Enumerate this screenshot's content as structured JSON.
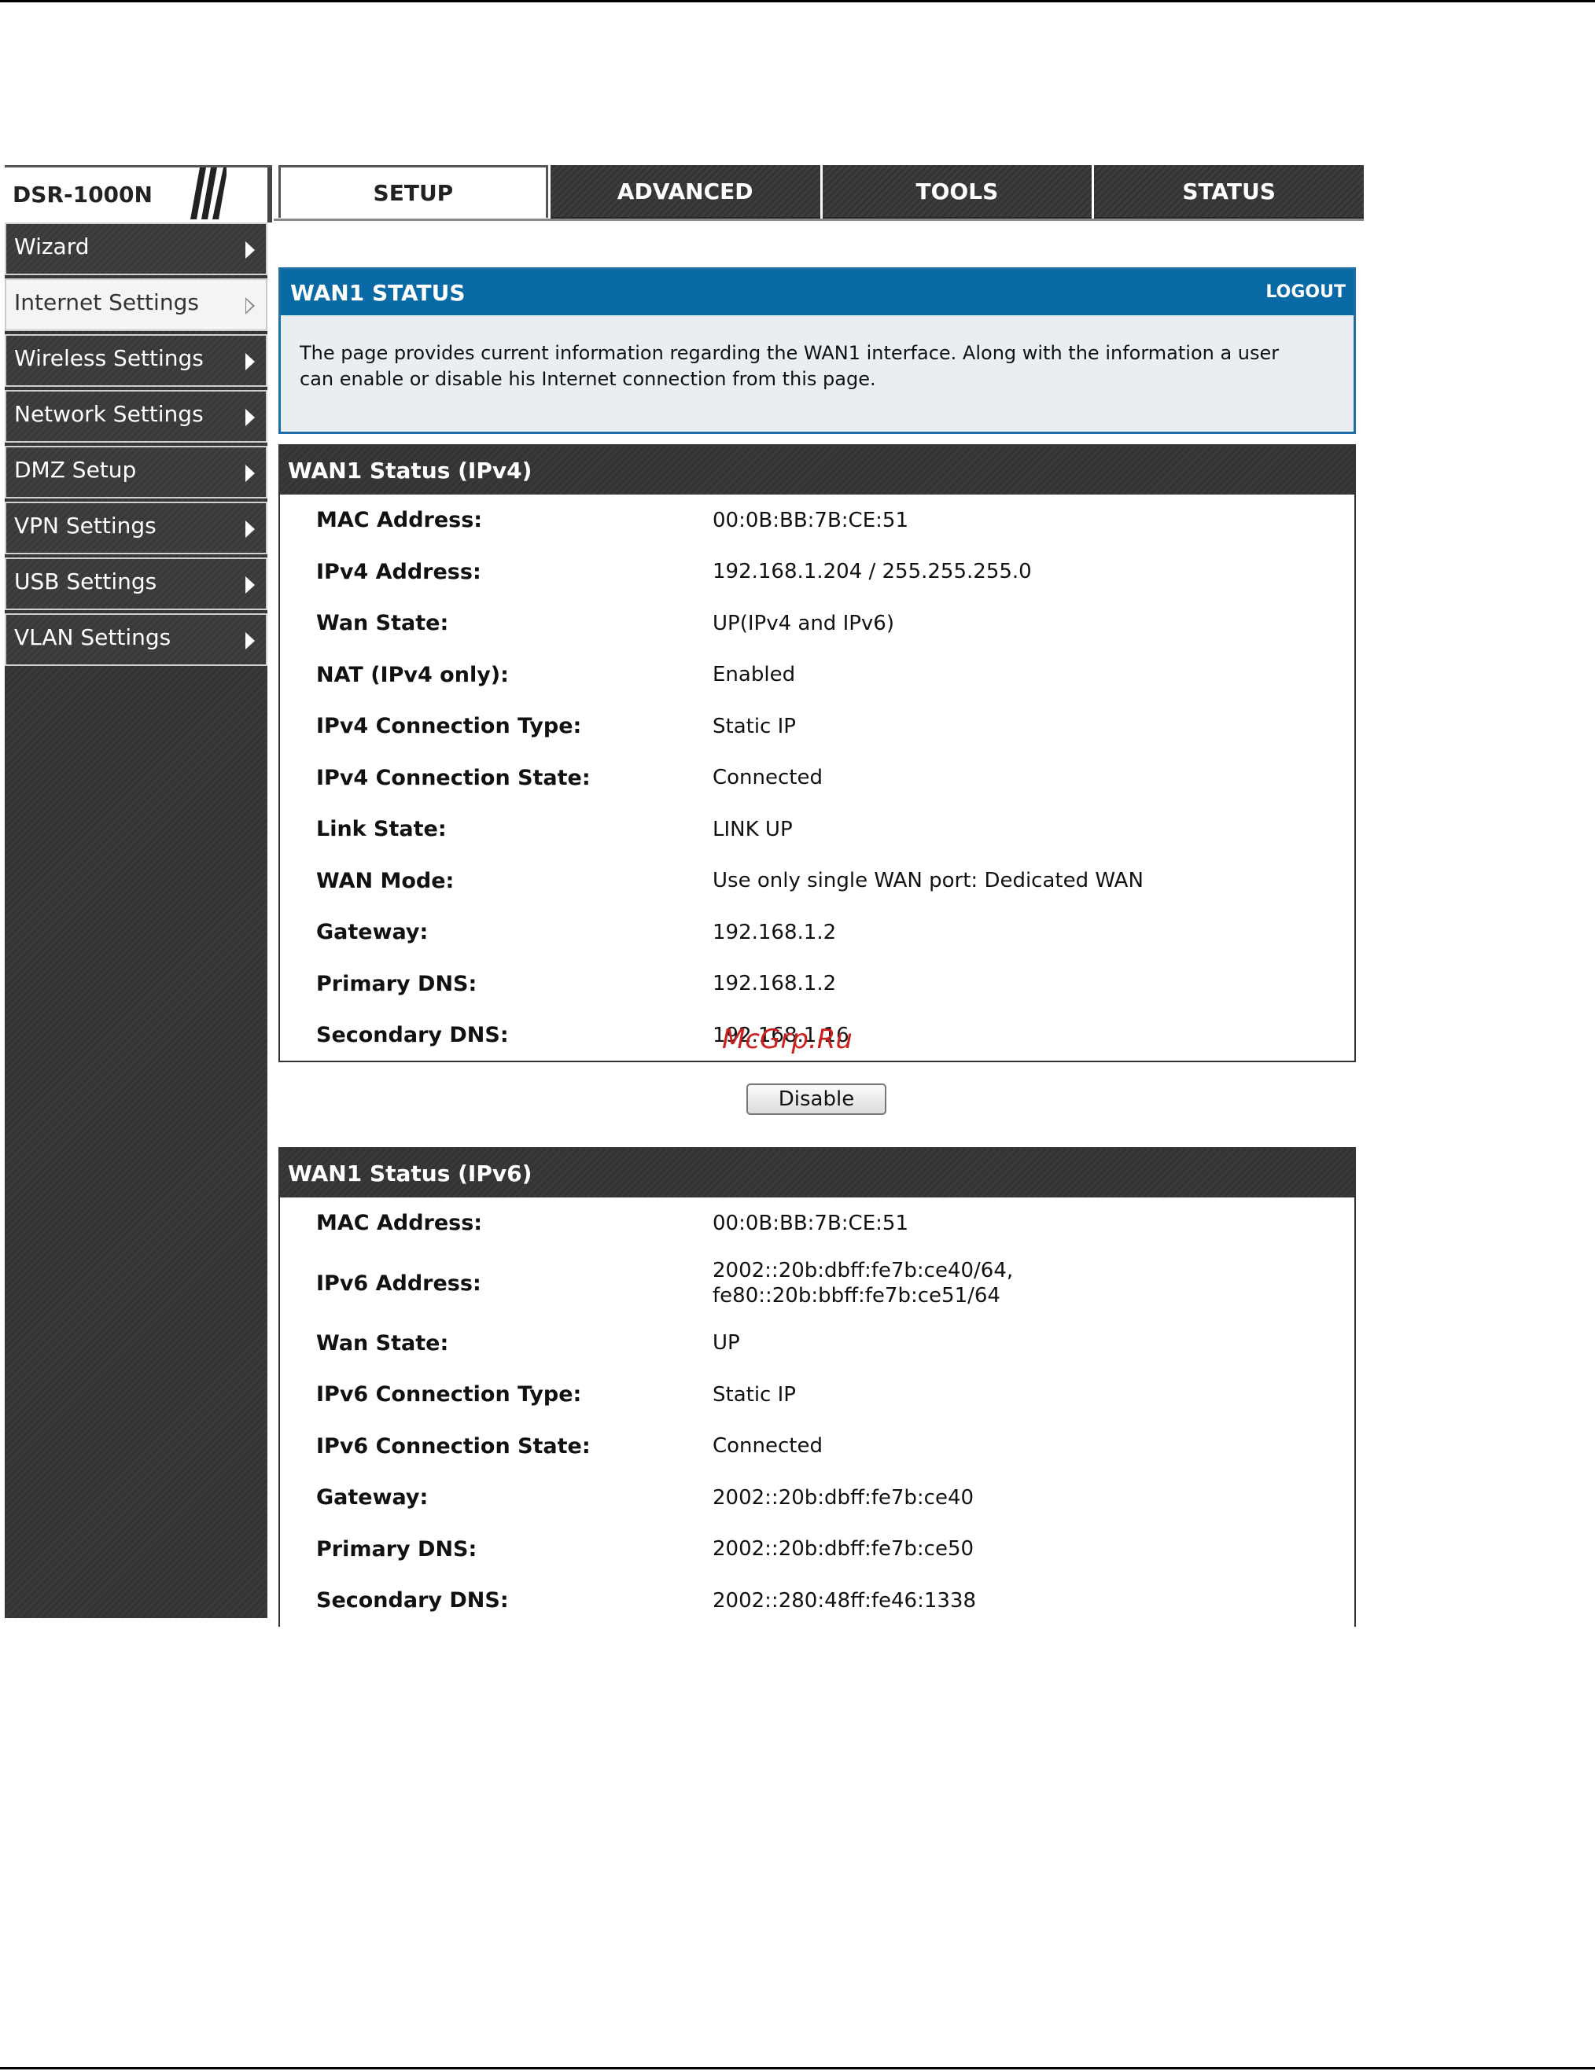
{
  "header": {
    "brand": "DSR-1000N",
    "tabs": [
      {
        "label": "SETUP",
        "active": true
      },
      {
        "label": "ADVANCED",
        "active": false
      },
      {
        "label": "TOOLS",
        "active": false
      },
      {
        "label": "STATUS",
        "active": false
      }
    ]
  },
  "sidebar": {
    "items": [
      {
        "label": "Wizard",
        "active": false
      },
      {
        "label": "Internet Settings",
        "active": true
      },
      {
        "label": "Wireless Settings",
        "active": false
      },
      {
        "label": "Network Settings",
        "active": false
      },
      {
        "label": "DMZ Setup",
        "active": false
      },
      {
        "label": "VPN Settings",
        "active": false
      },
      {
        "label": "USB Settings",
        "active": false
      },
      {
        "label": "VLAN Settings",
        "active": false
      }
    ]
  },
  "banner": {
    "title": "WAN1 STATUS",
    "logout": "LOGOUT",
    "line1": "The page provides current information regarding the WAN1 interface. Along with the information a user",
    "line2": "can enable or disable his Internet connection from this page."
  },
  "ipv4": {
    "title": "WAN1 Status (IPv4)",
    "rows": [
      {
        "label": "MAC Address:",
        "value": "00:0B:BB:7B:CE:51"
      },
      {
        "label": "IPv4 Address:",
        "value": "192.168.1.204 / 255.255.255.0"
      },
      {
        "label": "Wan State:",
        "value": "UP(IPv4 and IPv6)"
      },
      {
        "label": "NAT (IPv4 only):",
        "value": "Enabled"
      },
      {
        "label": "IPv4 Connection Type:",
        "value": "Static IP"
      },
      {
        "label": "IPv4 Connection State:",
        "value": "Connected"
      },
      {
        "label": "Link State:",
        "value": "LINK UP"
      },
      {
        "label": "WAN Mode:",
        "value": "Use only single WAN port: Dedicated WAN"
      },
      {
        "label": "Gateway:",
        "value": "192.168.1.2"
      },
      {
        "label": "Primary DNS:",
        "value": "192.168.1.2"
      },
      {
        "label": "Secondary DNS:",
        "value": "192.168.1.16"
      }
    ],
    "button": "Disable"
  },
  "ipv6": {
    "title": "WAN1 Status (IPv6)",
    "rows": [
      {
        "label": "MAC Address:",
        "value": "00:0B:BB:7B:CE:51"
      },
      {
        "label": "IPv6 Address:",
        "value": "2002::20b:dbff:fe7b:ce40/64,",
        "value2": "fe80::20b:bbff:fe7b:ce51/64"
      },
      {
        "label": "Wan State:",
        "value": "UP"
      },
      {
        "label": "IPv6 Connection Type:",
        "value": "Static IP"
      },
      {
        "label": "IPv6 Connection State:",
        "value": "Connected"
      },
      {
        "label": "Gateway:",
        "value": "2002::20b:dbff:fe7b:ce40"
      },
      {
        "label": "Primary DNS:",
        "value": "2002::20b:dbff:fe7b:ce50"
      },
      {
        "label": "Secondary DNS:",
        "value": "2002::280:48ff:fe46:1338"
      }
    ]
  },
  "watermark": "McGrp.Ru"
}
